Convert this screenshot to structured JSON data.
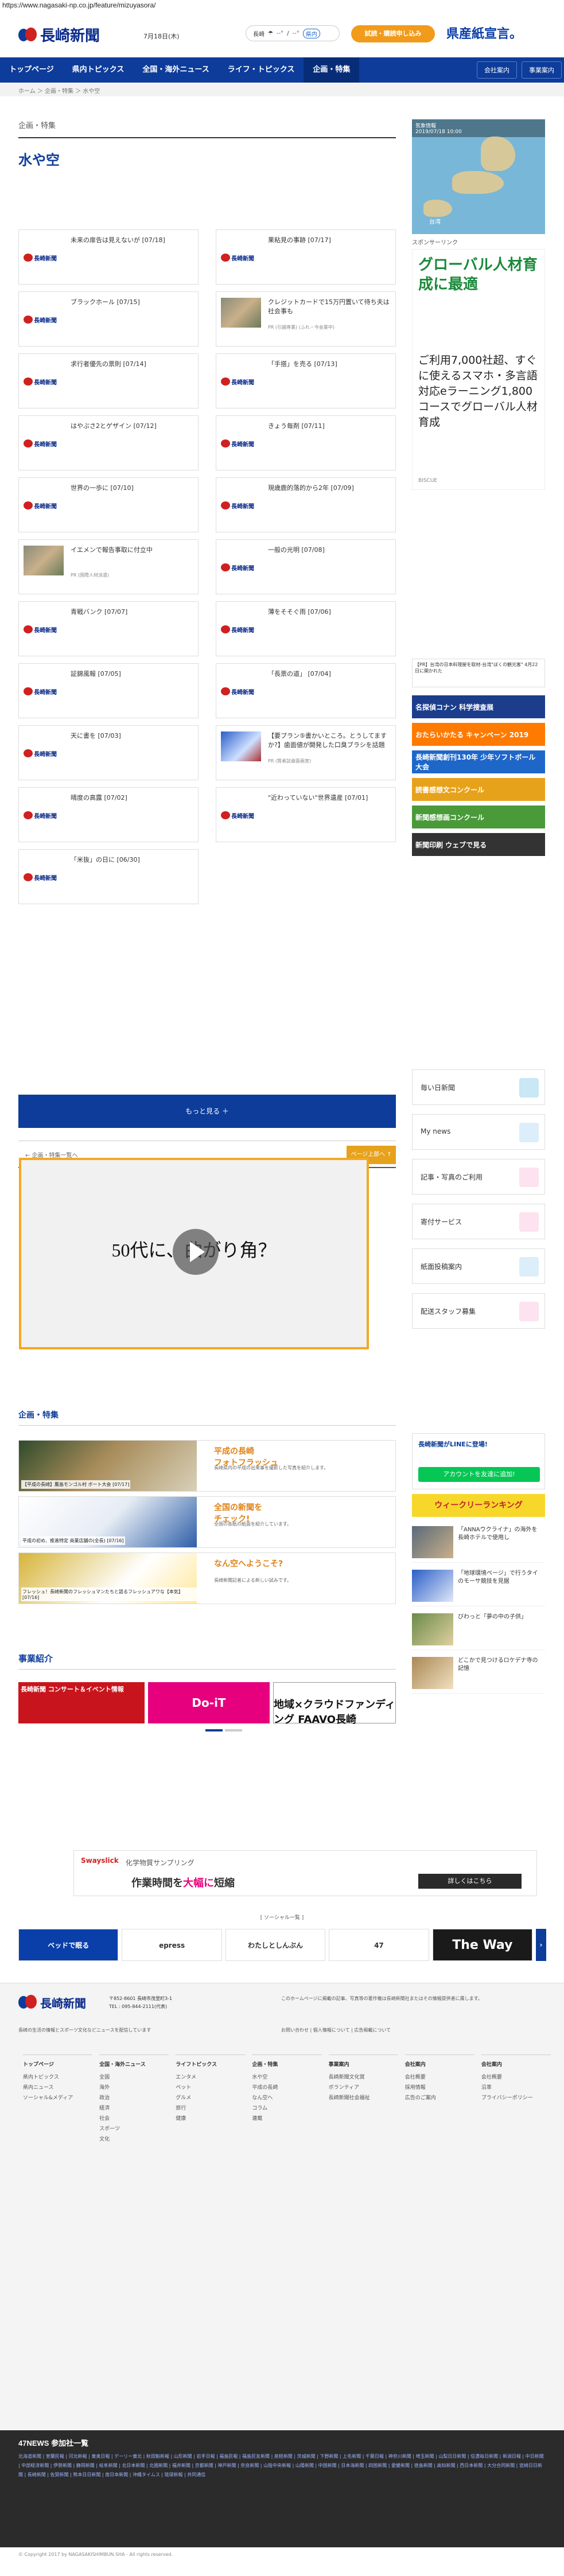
{
  "url": "https://www.nagasaki-np.co.jp/feature/mizuyasora/",
  "header": {
    "logo": "長崎新聞",
    "date": "7月18日(木)",
    "weather_label": "長崎",
    "weather_temp_high": "--°",
    "weather_temp_low": "--°",
    "weather_link": "県内",
    "trial_button": "試読・購読申し込み",
    "banner": "県産紙宣言。"
  },
  "nav": {
    "items": [
      "トップページ",
      "県内トピックス",
      "全国・海外ニュース",
      "ライフ・トピックス",
      "企画・特集"
    ],
    "right": [
      "会社案内",
      "事業案内"
    ]
  },
  "breadcrumb": "ホーム ＞ 企画・特集 ＞ 水や空",
  "page": {
    "section": "企画・特集",
    "title": "水や空"
  },
  "cards": [
    {
      "title": "未来の扉告は見えないが [07/18]",
      "sub": ""
    },
    {
      "title": "果粘見の事跡 [07/17]",
      "sub": ""
    },
    {
      "title": "ブラックホール [07/15]",
      "sub": ""
    },
    {
      "title": "クレジットカードで15万円置いて待ち夫は社会事も",
      "sub": "PR (引越専業) (ふれ・今会業中)"
    },
    {
      "title": "求行者優先の票則 [07/14]",
      "sub": ""
    },
    {
      "title": "「手搭」を売る [07/13]",
      "sub": ""
    },
    {
      "title": "はやぶさ2とゲザイン [07/12]",
      "sub": ""
    },
    {
      "title": "きょう毎剤 [07/11]",
      "sub": ""
    },
    {
      "title": "世界の一歩に [07/10]",
      "sub": ""
    },
    {
      "title": "現歳鹿的落的から2年 [07/09]",
      "sub": ""
    },
    {
      "title": "イエメンで報告事取に付立中",
      "sub": "PR (国際人材派遣)"
    },
    {
      "title": "一般の光明 [07/08]",
      "sub": ""
    },
    {
      "title": "青戦バンク [07/07]",
      "sub": ""
    },
    {
      "title": "薄をそそぐ雨 [07/06]",
      "sub": ""
    },
    {
      "title": "証錦風報 [07/05]",
      "sub": ""
    },
    {
      "title": "「長票の道」 [07/04]",
      "sub": ""
    },
    {
      "title": "天に書を [07/03]",
      "sub": ""
    },
    {
      "title": "【要プラン⑤書かいところ。とうしてますか?】歯面値が開発した口臭ブラシを話題",
      "sub": "PR (賢者誌歯面画室)"
    },
    {
      "title": "晴度の高露 [07/02]",
      "sub": ""
    },
    {
      "title": "\"近わっていない\"世界遺産 [07/01]",
      "sub": ""
    },
    {
      "title": "「米抜」の日に [06/30]",
      "sub": ""
    }
  ],
  "more_button": "もっと見る ＋",
  "pager": {
    "left": "← 企画・特集一覧へ",
    "top": "ページ上部へ ↑"
  },
  "video": {
    "text": "50代に、曲がり角？"
  },
  "feature_section": {
    "title": "企画・特集",
    "items": [
      {
        "title": "平成の長崎\nフォトフラッシュ",
        "caption": "【平成の長崎】鷹島モンゴル村 ボート大会 [07/17]",
        "desc": "長崎県内の平成の出来事を撮影した写真を紹介します。"
      },
      {
        "title": "全国の新聞を\nチェック!",
        "caption": "平成の初め、推進特定 商業店舗の(全長) [07/16]",
        "desc": "全国の各紙の紙面を紹介しています。"
      },
      {
        "title": "なん空へようこそ?",
        "caption": "フレッシュ！長崎新聞のフレッシュマンたちと語るフレッシュアワな【本気】 [07/16]",
        "desc": "長崎新聞記者による新しい試みです。"
      }
    ]
  },
  "business": {
    "title": "事業紹介",
    "banners": [
      "長崎新聞 コンサート＆イベント情報",
      "Do-iT",
      "地域×クラウドファンディング FAAVO長崎"
    ]
  },
  "adbar": {
    "brand": "Swayslick",
    "sub": "化学物質サンプリング",
    "main1": "作業時間を",
    "main2": "大幅に",
    "main3": "短縮",
    "cta": "詳しくはこちら"
  },
  "sponsor_label": "[ ソーシャル一覧 ]",
  "logostrip": [
    "ベッドで眠る",
    "epress",
    "わたしとしんぶん",
    "47",
    "The Way",
    "47"
  ],
  "footer": {
    "address": "〒852-8601 長崎市茂里町3-1\nTEL : 095-844-2111(代表)",
    "copy": "長崎の生活の情報とスポーツ文化などニュースを配信しています",
    "note": "このホームページに掲載の記事、写真等の著作権は長崎新聞社またはその情報提供者に属します。",
    "links": "お問い合わせ | 個人情報について | 広告掲載について",
    "cols": [
      {
        "h": "トップページ",
        "items": [
          "県内トピックス",
          "県内ニュース",
          "ソーシャル&メディア"
        ]
      },
      {
        "h": "全国・海外ニュース",
        "items": [
          "全国",
          "海外",
          "政治",
          "経済",
          "社会",
          "スポーツ",
          "文化"
        ]
      },
      {
        "h": "ライフトピックス",
        "items": [
          "エンタメ",
          "ペット",
          "グルメ",
          "旅行",
          "健康"
        ]
      },
      {
        "h": "企画・特集",
        "items": [
          "水や空",
          "平成の長崎",
          "なん空へ",
          "コラム",
          "連載"
        ]
      },
      {
        "h": "事業案内",
        "items": [
          "長崎新聞文化賞",
          "ボランティア",
          "長崎新聞社会福祉"
        ]
      },
      {
        "h": "会社案内",
        "items": [
          "会社概要",
          "採用情報",
          "広告のご案内"
        ]
      },
      {
        "h": "会社案内",
        "items": [
          "会社概要",
          "沿革",
          "プライバシーポリシー"
        ]
      }
    ]
  },
  "bottom": {
    "title": "47NEWS 参加社一覧",
    "list": "北海道新聞 | 室蘭民報 | 河北新報 | 東奥日報 | デーリー東北 | 秋田魁新報 | 山形新聞 | 岩手日報 | 福島民報 | 福島民友新聞 | 産経新聞 | 茨城新聞 | 下野新聞 | 上毛新聞 | 千葉日報 | 神奈川新聞 | 埼玉新聞 | 山梨日日新聞 | 信濃毎日新聞 | 新潟日報 | 中日新聞 | 中部経済新聞 | 伊勢新聞 | 静岡新聞 | 岐阜新聞 | 北日本新聞 | 北國新聞 | 福井新聞 | 京都新聞 | 神戸新聞 | 奈良新聞 | 山陰中央新報 | 山陽新聞 | 中国新聞 | 日本海新聞 | 四国新聞 | 愛媛新聞 | 徳島新聞 | 高知新聞 | 西日本新聞 | 大分合同新聞 | 宮崎日日新聞 | 長崎新聞 | 佐賀新聞 | 熊本日日新聞 | 南日本新聞 | 沖縄タイムス | 琉球新報 | 共同通信"
  },
  "copyright": "© Copyright 2017 by NAGASAKISHIMBUN.SHA - All rights reserved.",
  "side": {
    "map_title": "気象情報",
    "map_time": "2019/07/18 10:00",
    "map_label": "台湾",
    "sponsor": "スポンサーリンク",
    "ad_head": "グローバル人材育成に最適",
    "ad_body": "ご利用7,000社超、すぐに使えるスマホ・多言語対応eラーニング1,800コースでグローバル人材育成",
    "ad_foot": "BISCUE",
    "promo_text": "【PR】台湾の日本料理屋を取材-台湾\"ぼくの観光客\" 4月22日に開かれた",
    "banners": [
      "名探偵コナン 科学捜査展",
      "おたらいかたる キャンペーン 2019",
      "長崎新聞創刊130年 少年ソフトボール大会",
      "読書感想文コンクール",
      "新聞感想画コンクール",
      "新聞印刷 ウェブで見る"
    ],
    "services": [
      "毎い日新聞",
      "My news",
      "記事・写真のご利用",
      "寄付サービス",
      "紙面投稿案内",
      "配送スタッフ募集"
    ],
    "line_text": "長崎新聞がLINEに登場!",
    "line_button": "アカウントを友達に追加!",
    "ranking": "ウィークリーランキング",
    "side_items": [
      "「ANNAウクライナ」の海外を長崎ホテルで使用し",
      "「地球環境ページ」で行うタイのモーサ競技を見据",
      "びわっと「夢の中の子供」",
      "どこかで見つけるロケデナ寺の記憶"
    ]
  }
}
